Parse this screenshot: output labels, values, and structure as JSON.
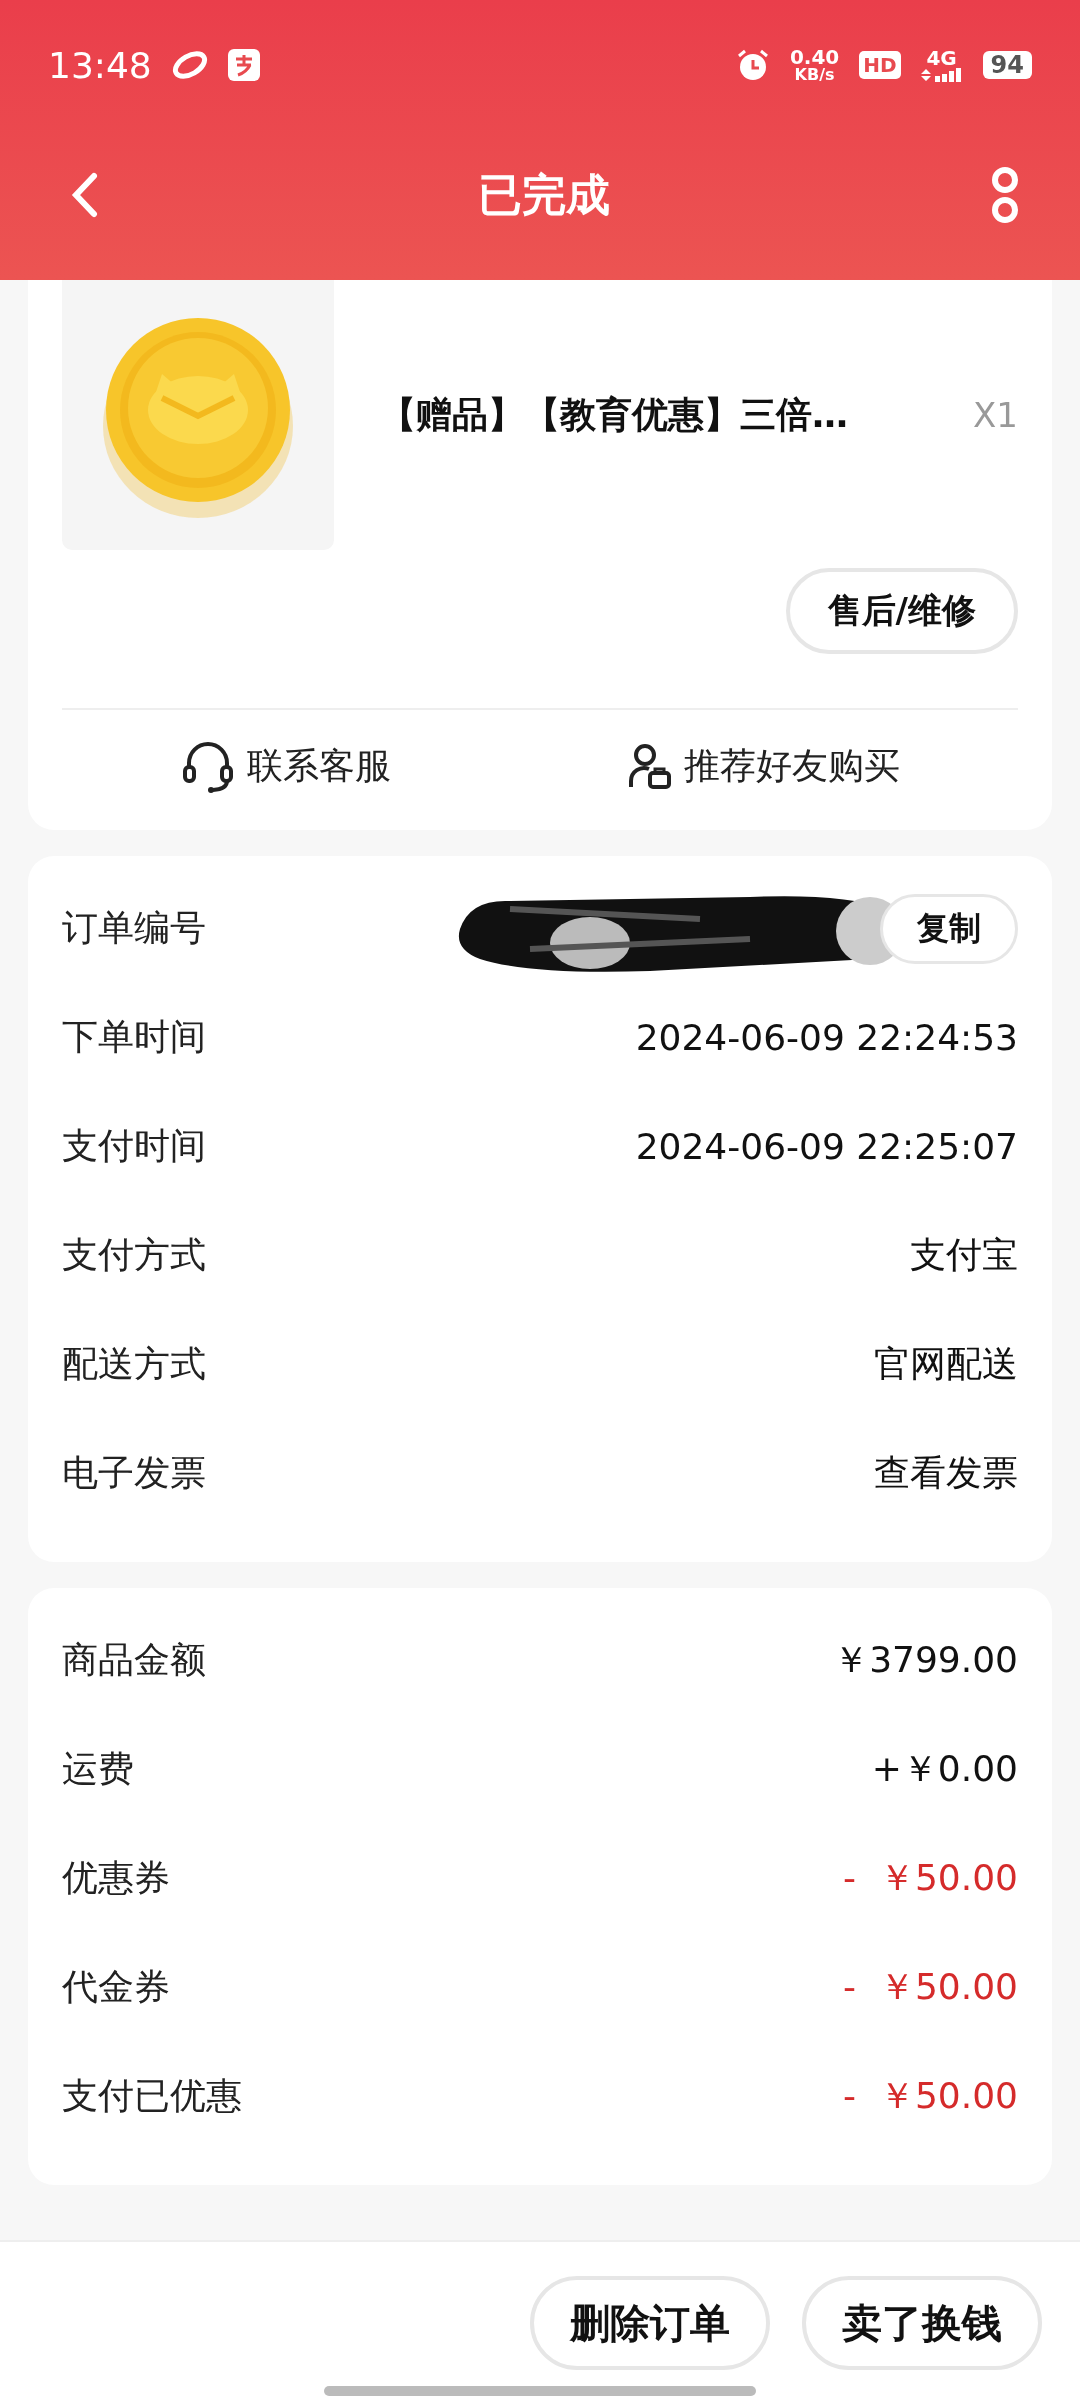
{
  "status_bar": {
    "time": "13:48",
    "speed": "0.40",
    "speed_unit": "KB/s",
    "hd": "HD",
    "network": "4G",
    "battery": "94"
  },
  "header": {
    "title": "已完成"
  },
  "product": {
    "title": "【赠品】【教育优惠】三倍…",
    "quantity": "X1",
    "button": "售后/维修"
  },
  "actions": [
    {
      "kind": "service",
      "label": "联系客服"
    },
    {
      "kind": "recommend",
      "label": "推荐好友购买"
    }
  ],
  "order_info": [
    {
      "label": "订单编号",
      "kind": "redacted",
      "action": "复制"
    },
    {
      "label": "下单时间",
      "value": "2024-06-09 22:24:53"
    },
    {
      "label": "支付时间",
      "value": "2024-06-09 22:25:07"
    },
    {
      "label": "支付方式",
      "value": "支付宝"
    },
    {
      "label": "配送方式",
      "value": "官网配送"
    },
    {
      "label": "电子发票",
      "value": "查看发票"
    }
  ],
  "amounts": [
    {
      "label": "商品金额",
      "value": "￥3799.00",
      "kind": "charge"
    },
    {
      "label": "运费",
      "value": "+￥0.00",
      "kind": "charge"
    },
    {
      "label": "优惠券",
      "value": "-  ￥50.00",
      "kind": "discount"
    },
    {
      "label": "代金券",
      "value": "-  ￥50.00",
      "kind": "discount"
    },
    {
      "label": "支付已优惠",
      "value": "-  ￥50.00",
      "kind": "discount"
    }
  ],
  "bottom_buttons": [
    "删除订单",
    "卖了换钱"
  ]
}
